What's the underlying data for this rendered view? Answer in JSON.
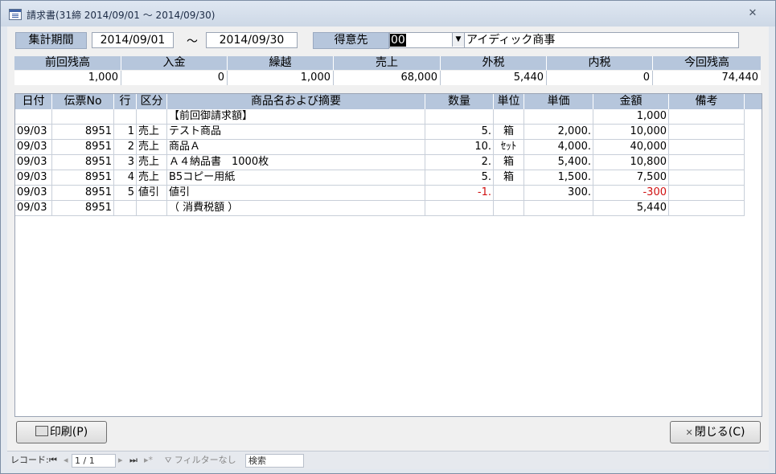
{
  "window": {
    "title": "請求書(31締 2014/09/01 ～ 2014/09/30)",
    "close_glyph": "✕"
  },
  "header": {
    "period_label": "集計期間",
    "period_from": "2014/09/01",
    "period_sep": "～",
    "period_to": "2014/09/30",
    "customer_label": "得意先",
    "customer_code": "00",
    "customer_name": "アイディック商事"
  },
  "summary": {
    "headers": [
      "前回残高",
      "入金",
      "繰越",
      "売上",
      "外税",
      "内税",
      "今回残高"
    ],
    "values": [
      "1,000",
      "0",
      "1,000",
      "68,000",
      "5,440",
      "0",
      "74,440"
    ]
  },
  "grid": {
    "columns": [
      "日付",
      "伝票No",
      "行",
      "区分",
      "商品名および摘要",
      "数量",
      "単位",
      "単価",
      "金額",
      "備考"
    ],
    "rows": [
      [
        "",
        "",
        "",
        "",
        "【前回御請求額】",
        "",
        "",
        "",
        "1,000",
        ""
      ],
      [
        "09/03",
        "8951",
        "1",
        "売上",
        "テスト商品",
        "5.",
        "箱",
        "2,000.",
        "10,000",
        ""
      ],
      [
        "09/03",
        "8951",
        "2",
        "売上",
        "商品Ａ",
        "10.",
        "ｾｯﾄ",
        "4,000.",
        "40,000",
        ""
      ],
      [
        "09/03",
        "8951",
        "3",
        "売上",
        "Ａ４納品書　1000枚",
        "2.",
        "箱",
        "5,400.",
        "10,800",
        ""
      ],
      [
        "09/03",
        "8951",
        "4",
        "売上",
        "B5コピー用紙",
        "5.",
        "箱",
        "1,500.",
        "7,500",
        ""
      ],
      [
        "09/03",
        "8951",
        "5",
        "値引",
        "値引",
        "-1.",
        "",
        "300.",
        "-300",
        ""
      ],
      [
        "09/03",
        "8951",
        "",
        "",
        "（ 消費税額 ）",
        "",
        "",
        "",
        "5,440",
        ""
      ]
    ]
  },
  "buttons": {
    "print": "印刷(P)",
    "close": "閉じる(C)"
  },
  "statusbar": {
    "record_label": "レコード:",
    "first_glyph": "⏮",
    "prev_glyph": "◂",
    "record_pos": "1 / 1",
    "next_glyph": "▸",
    "last_glyph": "⏭",
    "new_glyph": "▸*",
    "filter_label": "フィルターなし",
    "search_label": "検索"
  },
  "colors": {
    "header_bg": "#b6c6dc",
    "negative": "#d01010"
  }
}
